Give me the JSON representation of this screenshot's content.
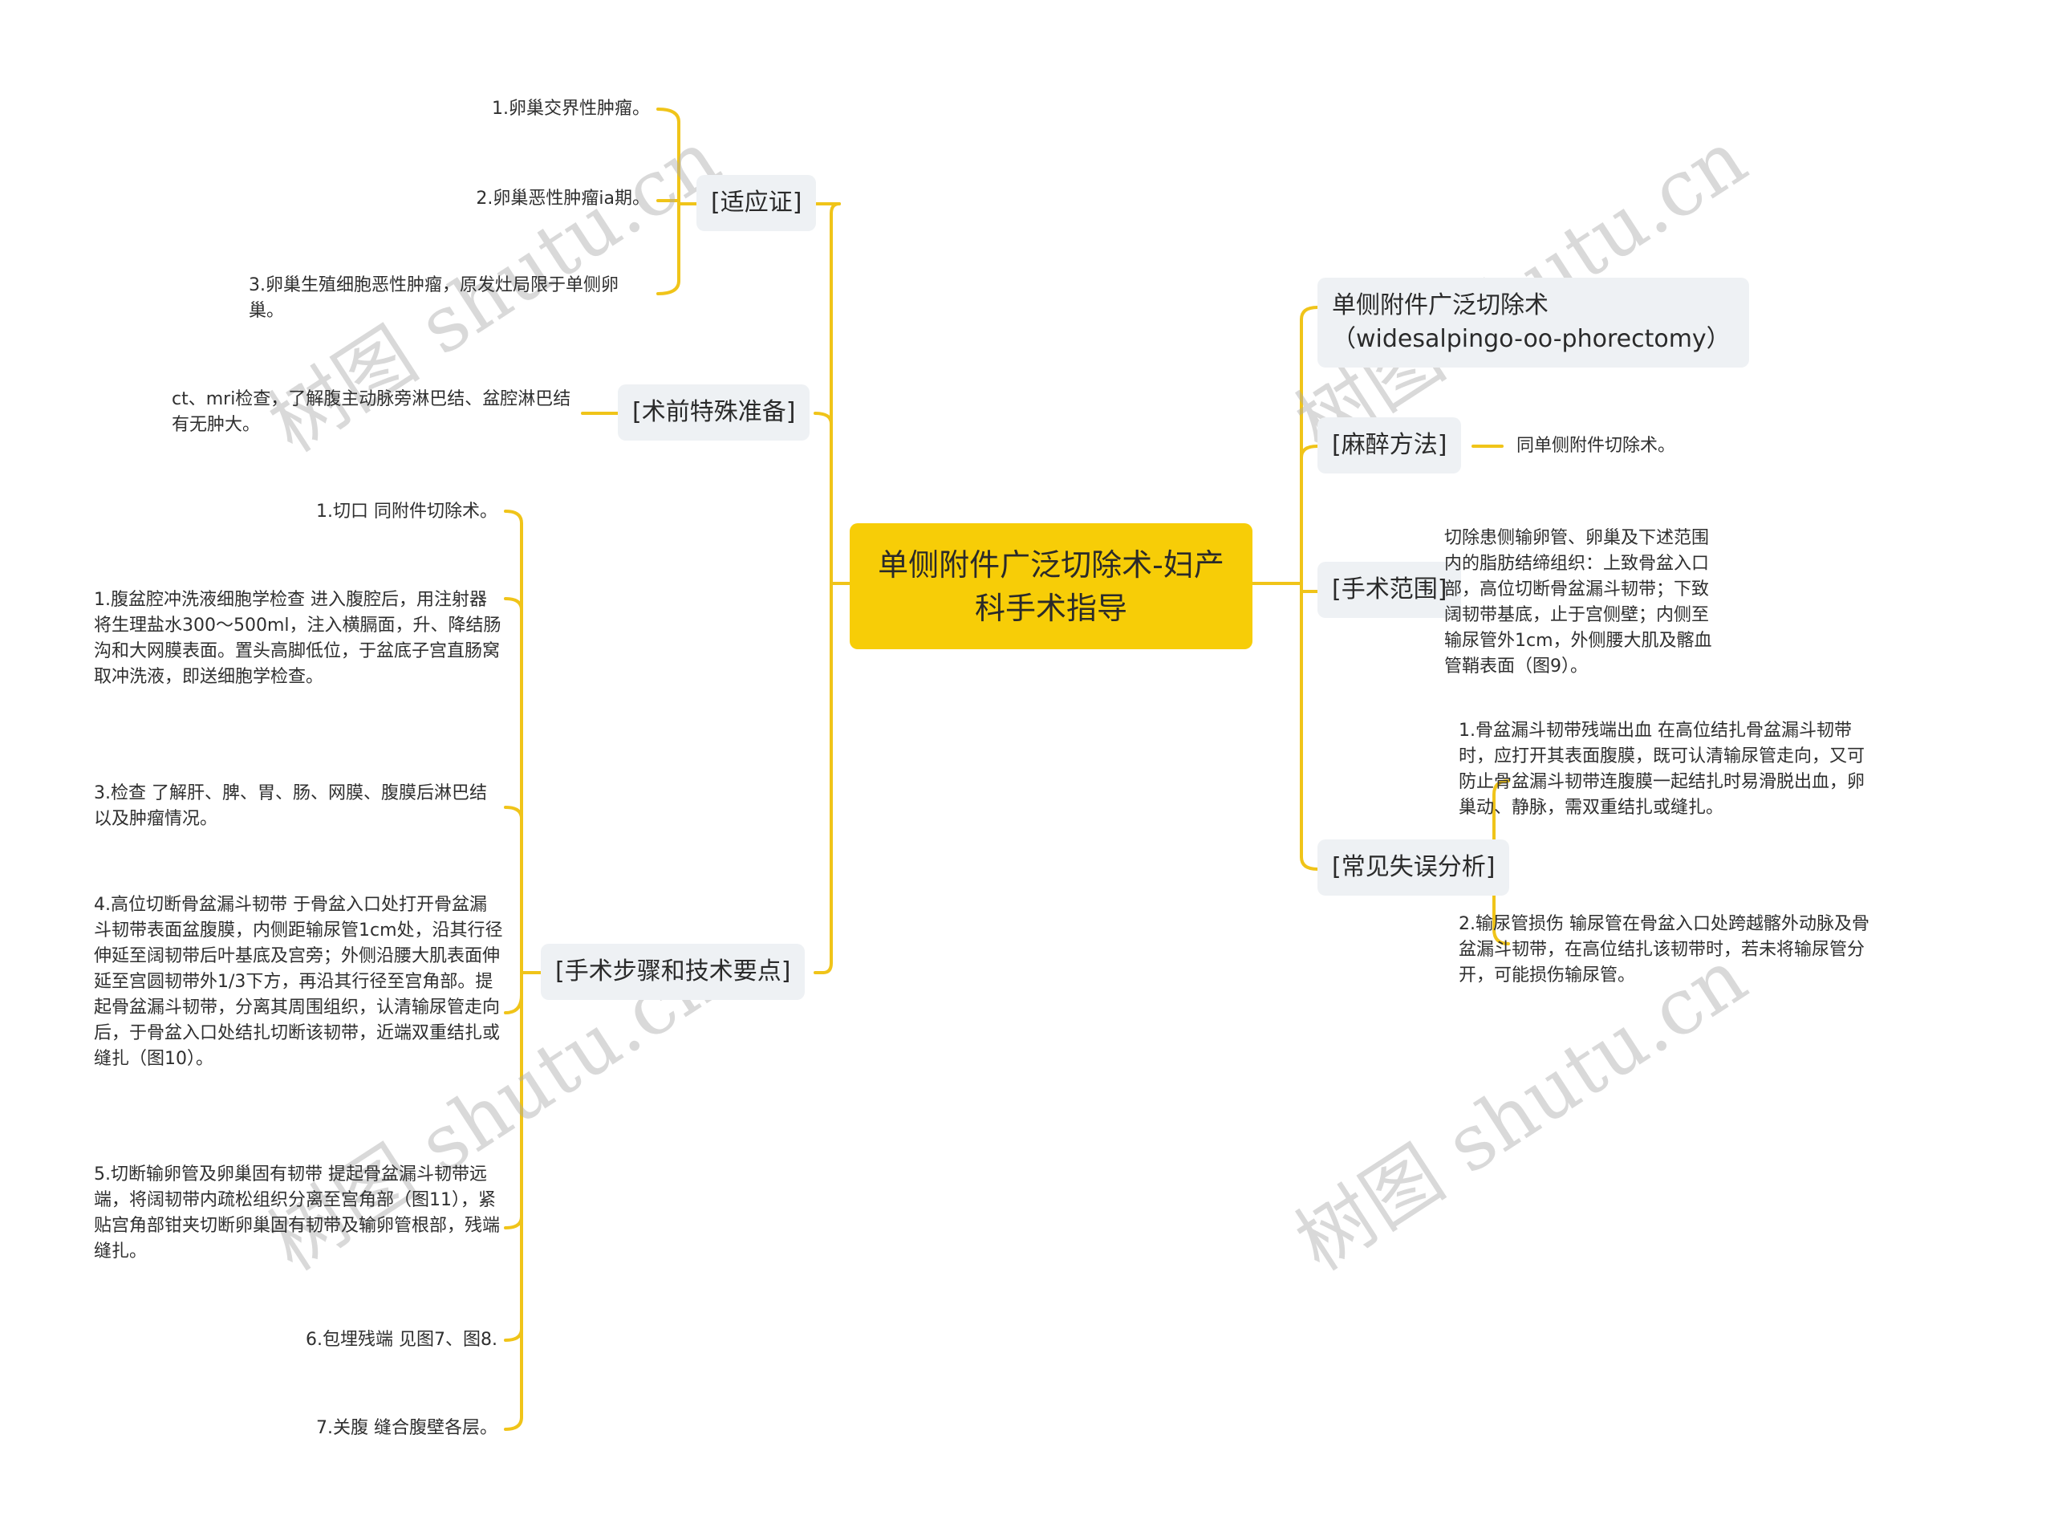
{
  "root": {
    "title": "单侧附件广泛切除术-妇产科手术指导"
  },
  "left": {
    "indications": {
      "label": "[适应证]",
      "items": [
        "1.卵巢交界性肿瘤。",
        "2.卵巢恶性肿瘤ia期。",
        "3.卵巢生殖细胞恶性肿瘤，原发灶局限于单侧卵巢。"
      ]
    },
    "preop": {
      "label": "[术前特殊准备]",
      "items": [
        "ct、mri检查，了解腹主动脉旁淋巴结、盆腔淋巴结有无肿大。"
      ]
    },
    "steps": {
      "label": "[手术步骤和技术要点]",
      "items": [
        "1.切口 同附件切除术。",
        "1.腹盆腔冲洗液细胞学检查 进入腹腔后，用注射器将生理盐水300～500ml，注入横膈面，升、降结肠沟和大网膜表面。置头高脚低位，于盆底子宫直肠窝取冲洗液，即送细胞学检查。",
        "3.检查 了解肝、脾、胃、肠、网膜、腹膜后淋巴结以及肿瘤情况。",
        "4.高位切断骨盆漏斗韧带 于骨盆入口处打开骨盆漏斗韧带表面盆腹膜，内侧距输尿管1cm处，沿其行径伸延至阔韧带后叶基底及宫旁；外侧沿腰大肌表面伸延至宫圆韧带外1/3下方，再沿其行径至宫角部。提起骨盆漏斗韧带，分离其周围组织，认清输尿管走向后，于骨盆入口处结扎切断该韧带，近端双重结扎或缝扎（图10）。",
        "5.切断输卵管及卵巢固有韧带 提起骨盆漏斗韧带远端，将阔韧带内疏松组织分离至宫角部（图11），紧贴宫角部钳夹切断卵巢固有韧带及输卵管根部，残端缝扎。",
        "6.包埋残端 见图7、图8.",
        "7.关腹 缝合腹壁各层。"
      ]
    }
  },
  "right": {
    "english_name": {
      "label": "单侧附件广泛切除术（widesalpingo-oo-phorectomy）"
    },
    "anesthesia": {
      "label": "[麻醉方法]",
      "items": [
        "同单侧附件切除术。"
      ]
    },
    "scope": {
      "label": "[手术范围]",
      "items": [
        "切除患侧输卵管、卵巢及下述范围内的脂肪结缔组织：上致骨盆入口部，高位切断骨盆漏斗韧带；下致阔韧带基底，止于宫侧壁；内侧至输尿管外1cm，外侧腰大肌及髂血管鞘表面（图9）。"
      ]
    },
    "errors": {
      "label": "[常见失误分析]",
      "items": [
        "1.骨盆漏斗韧带残端出血 在高位结扎骨盆漏斗韧带时，应打开其表面腹膜，既可认清输尿管走向，又可防止骨盆漏斗韧带连腹膜一起结扎时易滑脱出血，卵巢动、静脉，需双重结扎或缝扎。",
        "2.输尿管损伤 输尿管在骨盆入口处跨越髂外动脉及骨盆漏斗韧带，在高位结扎该韧带时，若未将输尿管分开，可能损伤输尿管。"
      ]
    }
  },
  "watermark": {
    "text": "树图 shutu.cn"
  },
  "colors": {
    "root_fill": "#f7cd07",
    "branch_fill": "#eef1f4",
    "connector": "#f0c419"
  }
}
